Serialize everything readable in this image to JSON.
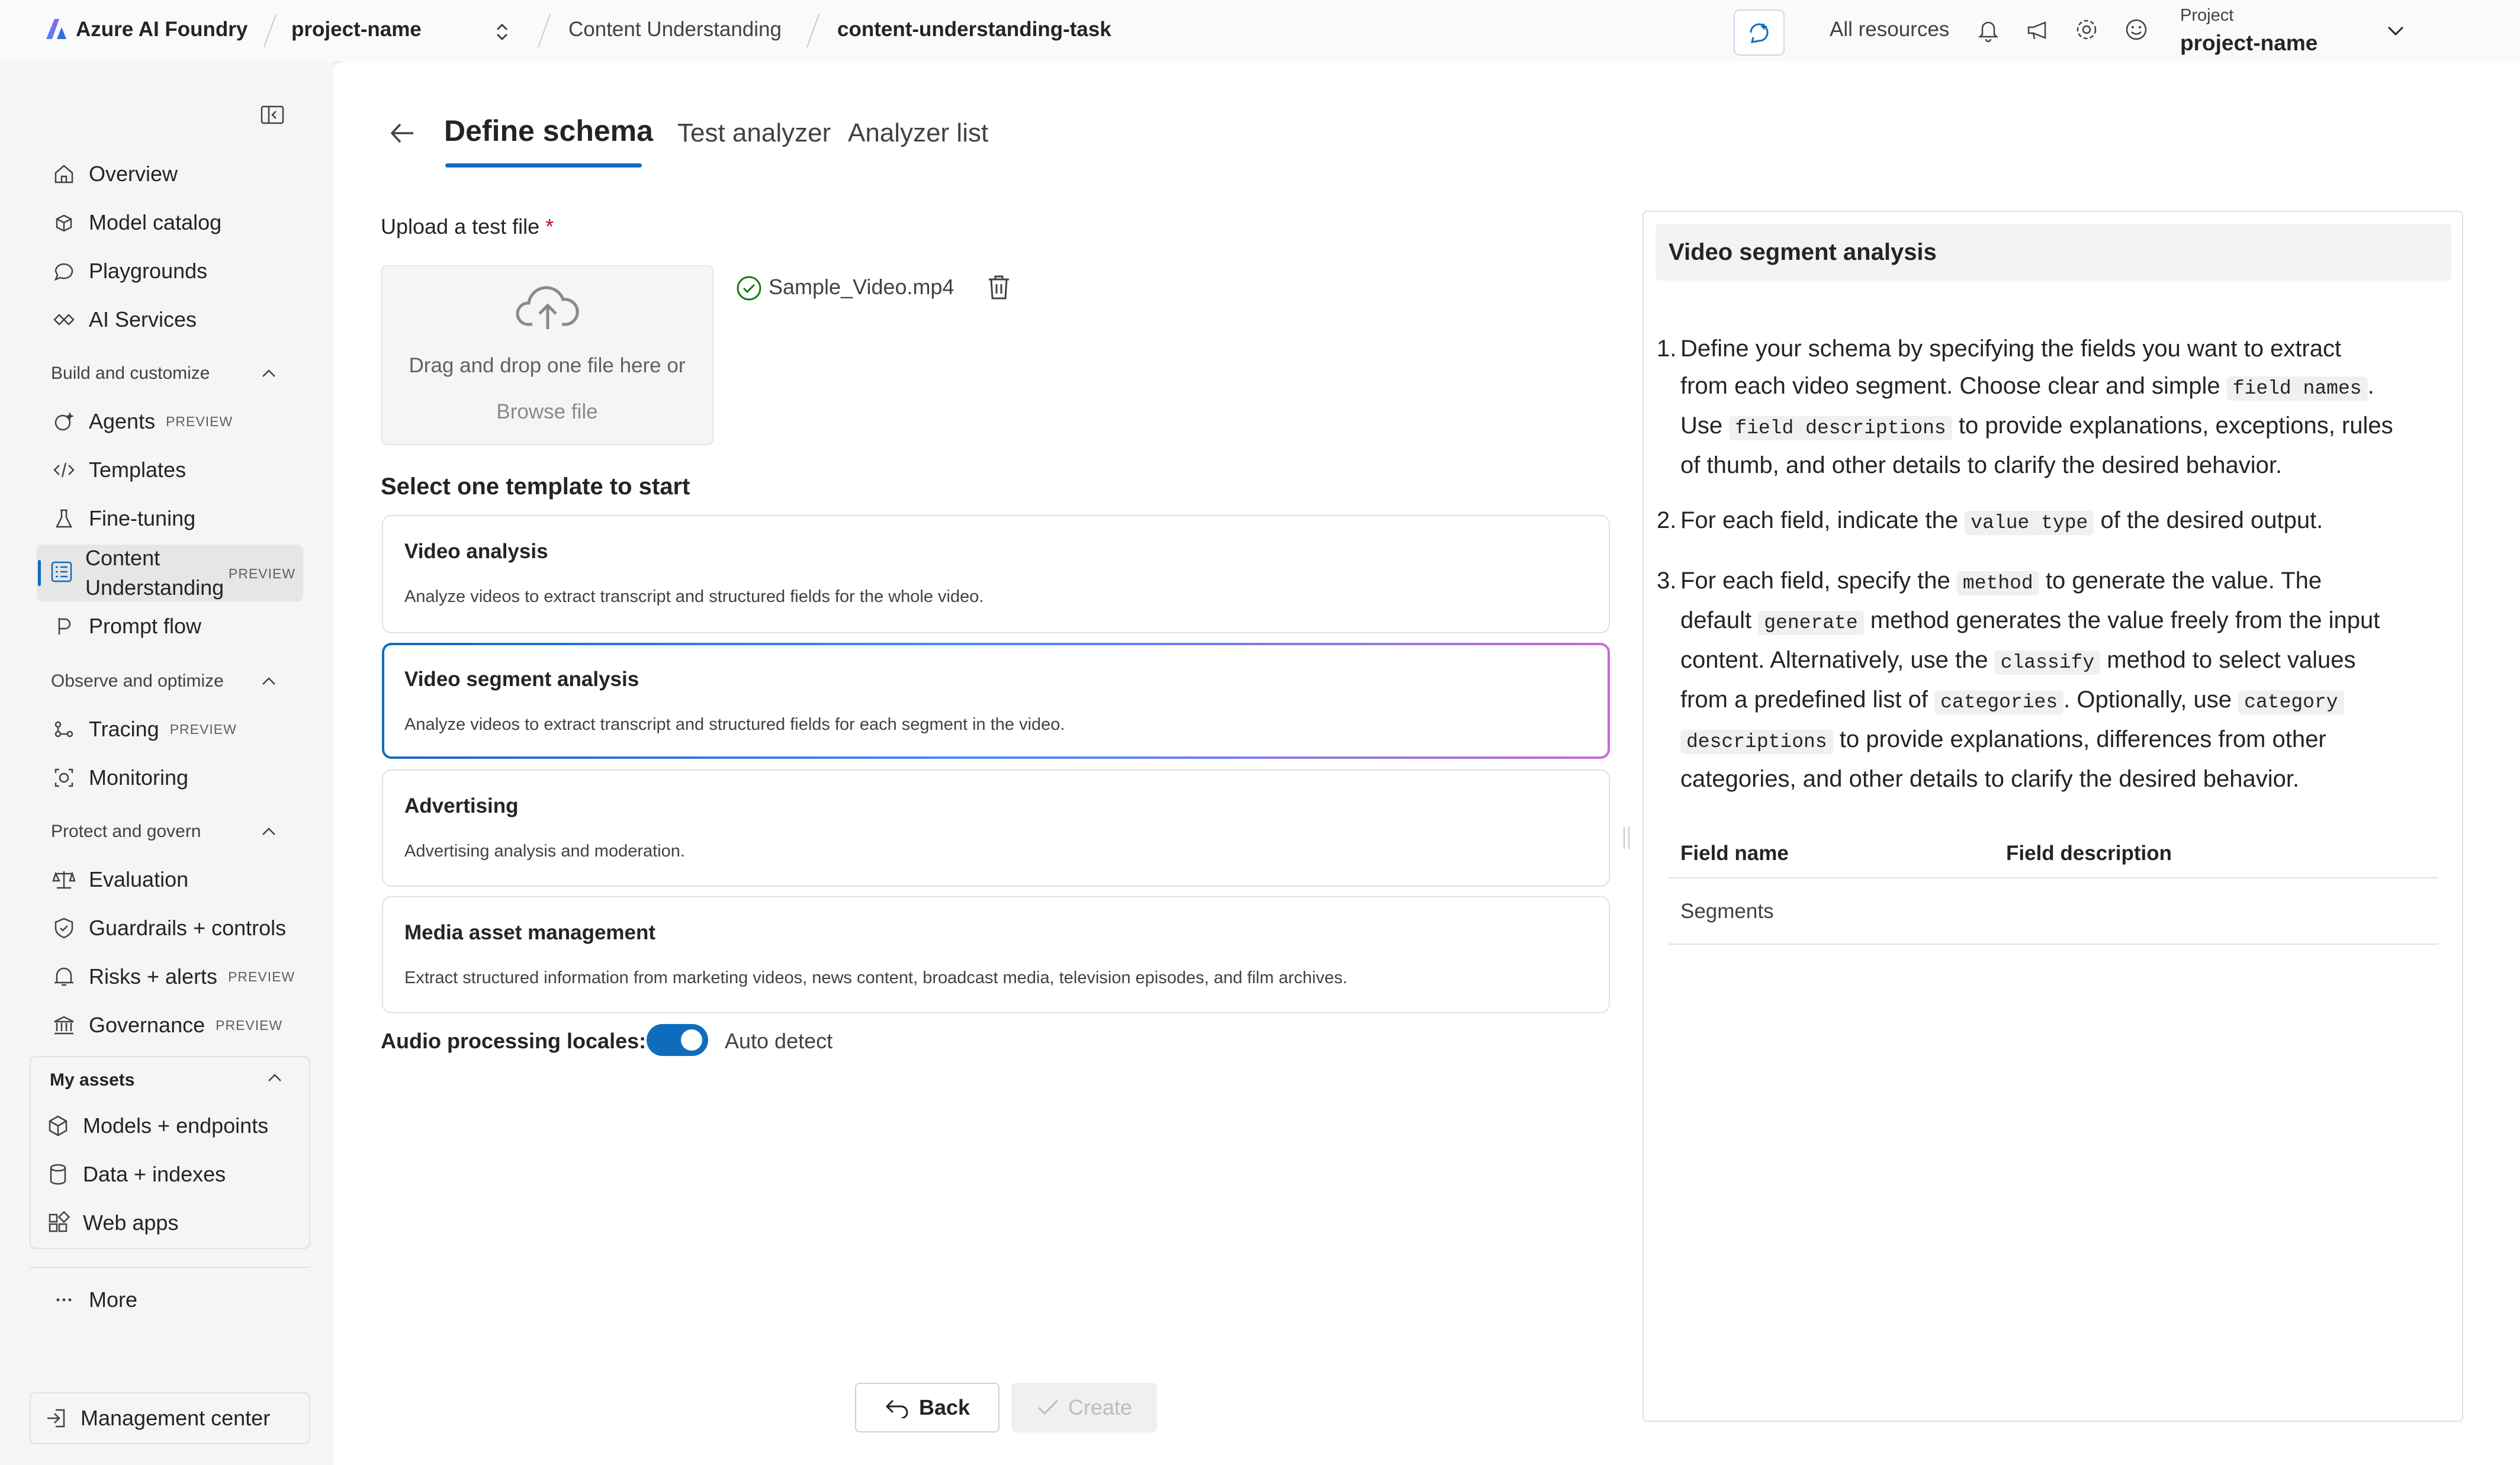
{
  "topbar": {
    "brand": "Azure AI Foundry",
    "project": "project-name",
    "crumb1": "Content Understanding",
    "crumb2": "content-understanding-task",
    "all_resources": "All resources",
    "project_label": "Project",
    "project_value": "project-name"
  },
  "sidebar": {
    "overview": "Overview",
    "model_catalog": "Model catalog",
    "playgrounds": "Playgrounds",
    "ai_services": "AI Services",
    "sec_build": "Build and customize",
    "agents": "Agents",
    "templates": "Templates",
    "fine_tuning": "Fine-tuning",
    "content_understanding_1": "Content",
    "content_understanding_2": "Understanding",
    "prompt_flow": "Prompt flow",
    "sec_observe": "Observe and optimize",
    "tracing": "Tracing",
    "monitoring": "Monitoring",
    "sec_protect": "Protect and govern",
    "evaluation": "Evaluation",
    "guardrails": "Guardrails + controls",
    "risks": "Risks + alerts",
    "governance": "Governance",
    "sec_assets": "My assets",
    "models_endpoints": "Models + endpoints",
    "data_indexes": "Data + indexes",
    "web_apps": "Web apps",
    "more": "More",
    "management_center": "Management center",
    "preview_badge": "PREVIEW"
  },
  "tabs": {
    "define_schema": "Define schema",
    "test_analyzer": "Test analyzer",
    "analyzer_list": "Analyzer list"
  },
  "upload": {
    "label": "Upload a test file",
    "required_mark": "*",
    "drop_text": "Drag and drop one file here or",
    "browse": "Browse file",
    "file_name": "Sample_Video.mp4"
  },
  "templates_section": {
    "heading": "Select one template to start",
    "items": [
      {
        "title": "Video analysis",
        "desc": "Analyze videos to extract transcript and structured fields for the whole video."
      },
      {
        "title": "Video segment analysis",
        "desc": "Analyze videos to extract transcript and structured fields for each segment in the video."
      },
      {
        "title": "Advertising",
        "desc": "Advertising analysis and moderation."
      },
      {
        "title": "Media asset management",
        "desc": "Extract structured information from marketing videos, news content, broadcast media, television episodes, and film archives."
      }
    ]
  },
  "audio": {
    "label": "Audio processing locales:",
    "toggle_on": true,
    "value": "Auto detect"
  },
  "buttons": {
    "back": "Back",
    "create": "Create"
  },
  "panel": {
    "title": "Video segment analysis",
    "s1a": "Define your schema by specifying the fields you want to extract",
    "s1b": "from each video segment. Choose clear and simple",
    "c_field_names": "field names",
    "s1c": "Use",
    "c_field_descriptions": "field descriptions",
    "s1d": "to provide explanations, exceptions, rules",
    "s1e": "of thumb, and other details to clarify the desired behavior.",
    "s2a": "For each field, indicate the",
    "c_value_type": "value type",
    "s2b": "of the desired output.",
    "s3a": "For each field, specify the",
    "c_method": "method",
    "s3b": "to generate the value. The",
    "s3c": "default",
    "c_generate": "generate",
    "s3d": "method generates the value freely from the input",
    "s3e": "content. Alternatively, use the",
    "c_classify": "classify",
    "s3f": "method to select values",
    "s3g": "from a predefined list of",
    "c_categories": "categories",
    "s3h": ". Optionally, use",
    "c_category": "category",
    "c_descriptions": "descriptions",
    "s3i": "to provide explanations, differences from other",
    "s3j": "categories, and other details to clarify the desired behavior.",
    "th_name": "Field name",
    "th_desc": "Field description",
    "row1_name": "Segments"
  },
  "colors": {
    "accent": "#0f6cbd",
    "success": "#107c10",
    "brand_gradient": [
      "#3d8bff",
      "#9b5de5"
    ]
  }
}
